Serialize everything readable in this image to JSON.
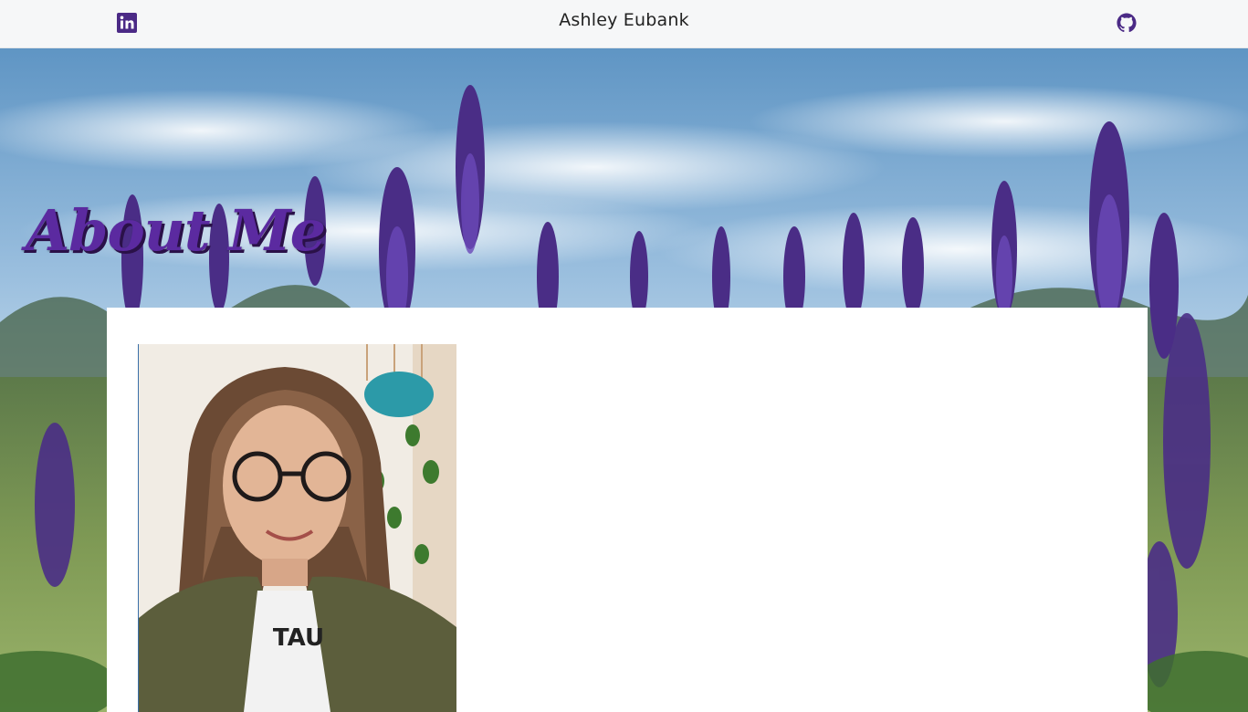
{
  "navbar": {
    "site_title": "Ashley Eubank",
    "linkedin_icon": "linkedin-icon",
    "github_icon": "github-icon",
    "icon_color": "#4b2a86"
  },
  "hero": {
    "heading": "About Me",
    "heading_color": "#5b2aa0",
    "background": "lupine-flowers-field"
  },
  "profile": {
    "photo": "profile-photo"
  }
}
